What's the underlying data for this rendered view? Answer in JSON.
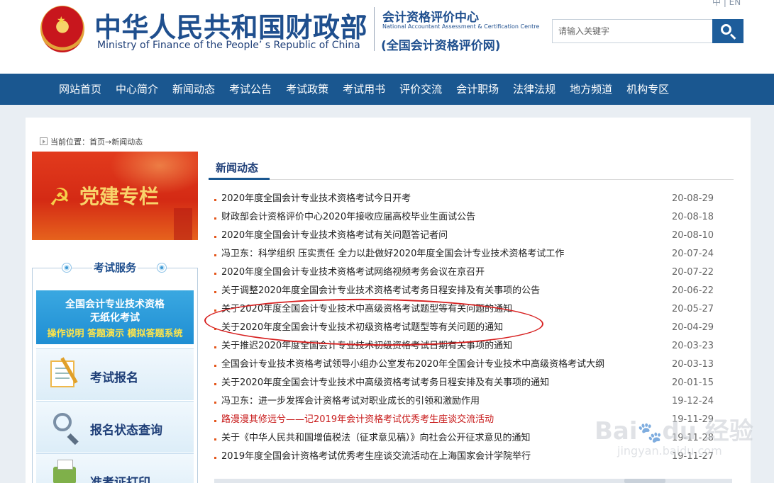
{
  "header": {
    "title_cn": "中华人民共和国财政部",
    "title_en": "Ministry of Finance of the People’ s Republic of China",
    "center_cn": "会计资格评价中心",
    "center_en": "National Accountant Assessment & Certification Centre",
    "center_net": "(全国会计资格评价网)",
    "lang": "中 | EN",
    "search_placeholder": "请输入关键字"
  },
  "nav": {
    "items": [
      "网站首页",
      "中心简介",
      "新闻动态",
      "考试公告",
      "考试政策",
      "考试用书",
      "评价交流",
      "会计职场",
      "法律法规",
      "地方频道",
      "机构专区"
    ]
  },
  "breadcrumb": "当前位置：首页→新闻动态",
  "sidebar": {
    "party_banner": "党建专栏",
    "service_title": "考试服务",
    "paperless": {
      "line1": "全国会计专业技术资格",
      "line2": "无纸化考试",
      "line3": "操作说明 答题演示 模拟答题系统"
    },
    "services": [
      "考试报名",
      "报名状态查询",
      "准考证打印"
    ]
  },
  "news": {
    "section_title": "新闻动态",
    "items": [
      {
        "title": "2020年度全国会计专业技术资格考试今日开考",
        "date": "20-08-29",
        "highlight": false
      },
      {
        "title": "财政部会计资格评价中心2020年接收应届高校毕业生面试公告",
        "date": "20-08-18",
        "highlight": false
      },
      {
        "title": "2020年度全国会计专业技术资格考试有关问题答记者问",
        "date": "20-08-10",
        "highlight": false
      },
      {
        "title": "冯卫东：科学组织 压实责任 全力以赴做好2020年度全国会计专业技术资格考试工作",
        "date": "20-07-24",
        "highlight": false
      },
      {
        "title": "2020年度全国会计专业技术资格考试网络视频考务会议在京召开",
        "date": "20-07-22",
        "highlight": false
      },
      {
        "title": "关于调整2020年度全国会计专业技术资格考试考务日程安排及有关事项的公告",
        "date": "20-06-22",
        "highlight": false
      },
      {
        "title": "关于2020年度全国会计专业技术中高级资格考试题型等有关问题的通知",
        "date": "20-05-27",
        "highlight": false
      },
      {
        "title": "关于2020年度全国会计专业技术初级资格考试题型等有关问题的通知",
        "date": "20-04-29",
        "highlight": false
      },
      {
        "title": "关于推迟2020年度全国会计专业技术初级资格考试日期有关事项的通知",
        "date": "20-03-23",
        "highlight": false
      },
      {
        "title": "全国会计专业技术资格考试领导小组办公室发布2020年全国会计专业技术中高级资格考试大纲",
        "date": "20-03-13",
        "highlight": false
      },
      {
        "title": "关于2020年度全国会计专业技术中高级资格考试考务日程安排及有关事项的通知",
        "date": "20-01-15",
        "highlight": false
      },
      {
        "title": "冯卫东：进一步发挥会计资格考试对职业成长的引领和激励作用",
        "date": "19-12-24",
        "highlight": false
      },
      {
        "title": "路漫漫其修远兮——记2019年会计资格考试优秀考生座谈交流活动",
        "date": "19-11-29",
        "highlight": true
      },
      {
        "title": "关于《中华人民共和国增值税法（征求意见稿）》向社会公开征求意见的通知",
        "date": "19-11-28",
        "highlight": false
      },
      {
        "title": "2019年度全国会计资格考试优秀考生座谈交流活动在上海国家会计学院举行",
        "date": "19-11-27",
        "highlight": false
      }
    ]
  },
  "watermark": {
    "logo": "Bai du 经验",
    "sub": "jingyan.baidu.com"
  },
  "colors": {
    "brand_blue": "#1a5790",
    "title_blue": "#1f4f8e",
    "party_red": "#d42a14",
    "highlight_red": "#c81a1a",
    "annotation_red": "#d72020"
  }
}
